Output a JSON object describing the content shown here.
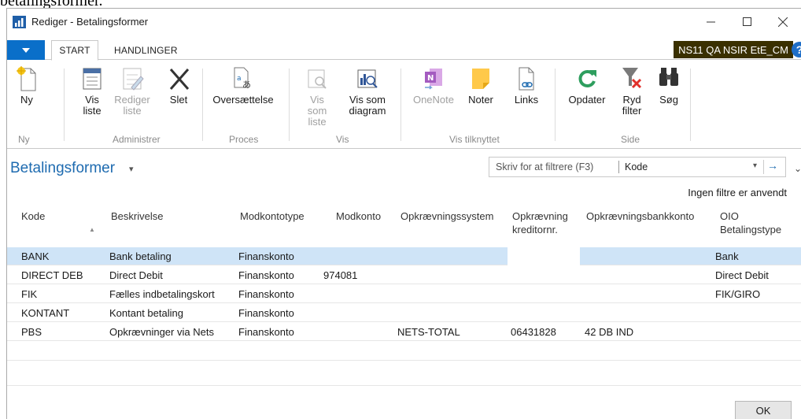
{
  "document_caption": "betalingsformer.",
  "window": {
    "title": "Rediger - Betalingsformer",
    "minimize": "—",
    "maximize": "☐",
    "close": "✕"
  },
  "tabs": {
    "start": "START",
    "handlinger": "HANDLINGER"
  },
  "company": "NS11 QA NSIR EtE_CM",
  "help": "?",
  "ribbon": {
    "ny": "Ny",
    "vis_liste_1": "Vis",
    "vis_liste_2": "liste",
    "rediger_liste_1": "Rediger",
    "rediger_liste_2": "liste",
    "slet": "Slet",
    "oversaettelse": "Oversættelse",
    "vis_som_liste_1": "Vis som",
    "vis_som_liste_2": "liste",
    "vis_som_diagram_1": "Vis som",
    "vis_som_diagram_2": "diagram",
    "onenote": "OneNote",
    "noter": "Noter",
    "links": "Links",
    "opdater": "Opdater",
    "ryd_filter_1": "Ryd",
    "ryd_filter_2": "filter",
    "soeg": "Søg",
    "groups": {
      "ny": "Ny",
      "administrer": "Administrer",
      "proces": "Proces",
      "vis": "Vis",
      "vis_tilknyttet": "Vis tilknyttet",
      "side": "Side"
    }
  },
  "page": {
    "title": "Betalingsformer",
    "title_caret": "▾",
    "filter_placeholder": "Skriv for at filtrere (F3)",
    "filter_field": "Kode",
    "filter_dropdown": "▾",
    "filter_go": "→",
    "expand": "⌄",
    "no_filters": "Ingen filtre er anvendt"
  },
  "table": {
    "headers": {
      "kode": "Kode",
      "beskrivelse": "Beskrivelse",
      "modkontotype": "Modkontotype",
      "modkonto": "Modkonto",
      "opkraevningssystem": "Opkrævningssystem",
      "opkraevning_kreditornr_1": "Opkrævning",
      "opkraevning_kreditornr_2": "kreditornr.",
      "opkraevningsbankkonto": "Opkrævningsbankkonto",
      "oio_1": "OIO",
      "oio_2": "Betalingstype"
    },
    "sort_indicator": "▲",
    "rows": [
      {
        "kode": "BANK",
        "beskrivelse": "Bank betaling",
        "modkontotype": "Finanskonto",
        "modkonto": "",
        "system": "",
        "kreditornr": "",
        "bankkonto": "",
        "oio": "Bank"
      },
      {
        "kode": "DIRECT DEB",
        "beskrivelse": "Direct Debit",
        "modkontotype": "Finanskonto",
        "modkonto": "974081",
        "system": "",
        "kreditornr": "",
        "bankkonto": "",
        "oio": "Direct Debit"
      },
      {
        "kode": "FIK",
        "beskrivelse": "Fælles indbetalingskort",
        "modkontotype": "Finanskonto",
        "modkonto": "",
        "system": "",
        "kreditornr": "",
        "bankkonto": "",
        "oio": "FIK/GIRO"
      },
      {
        "kode": "KONTANT",
        "beskrivelse": "Kontant betaling",
        "modkontotype": "Finanskonto",
        "modkonto": "",
        "system": "",
        "kreditornr": "",
        "bankkonto": "",
        "oio": ""
      },
      {
        "kode": "PBS",
        "beskrivelse": "Opkrævninger via Nets",
        "modkontotype": "Finanskonto",
        "modkonto": "",
        "system": "NETS-TOTAL",
        "kreditornr": "06431828",
        "bankkonto": "42 DB IND",
        "oio": ""
      }
    ]
  },
  "ok_label": "OK",
  "colors": {
    "accent": "#0a6fc9",
    "title_blue": "#1e6bb0",
    "selected_row": "#cfe4f7",
    "company_bg": "#3a3000"
  }
}
